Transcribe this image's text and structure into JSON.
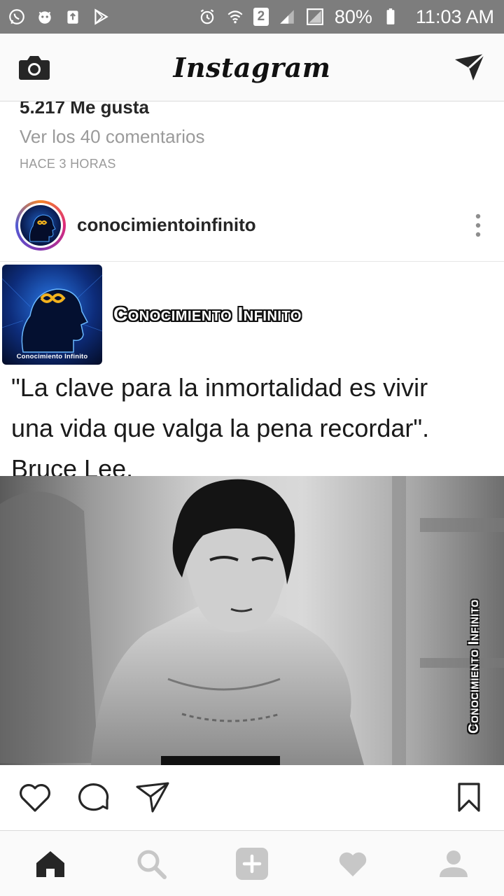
{
  "status_bar": {
    "left_icons": [
      "whatsapp-icon",
      "notification-app-icon",
      "recycle-icon",
      "play-store-icon"
    ],
    "right_icons": [
      "alarm-icon",
      "wifi-icon",
      "signal-icon",
      "signal-icon"
    ],
    "sim_label": "2",
    "battery_percent": "80%",
    "time": "11:03 AM"
  },
  "header": {
    "title": "Instagram",
    "camera_icon": "camera-icon",
    "direct_icon": "direct-message-icon"
  },
  "previous_post": {
    "likes": "5.217 Me gusta",
    "view_comments": "Ver los 40 comentarios",
    "time_ago": "HACE 3 HORAS"
  },
  "post": {
    "username": "conocimientoinfinito",
    "brand_title": "Conocimiento Infinito",
    "brand_thumb_label": "Conocimiento Infinito",
    "quote_line1": "\"La clave para la inmortalidad es vivir",
    "quote_line2": "una vida que valga la pena recordar\".",
    "quote_line3": "Bruce Lee.",
    "watermark": "Conocimiento Infinito"
  },
  "actions": {
    "like_icon": "heart-icon",
    "comment_icon": "comment-icon",
    "share_icon": "share-icon",
    "save_icon": "bookmark-icon"
  },
  "bottom_nav": {
    "items": [
      "home-icon",
      "search-icon",
      "add-icon",
      "activity-heart-icon",
      "profile-icon"
    ],
    "colors": {
      "active": "#262626",
      "inactive": "#c7c7c7"
    }
  }
}
